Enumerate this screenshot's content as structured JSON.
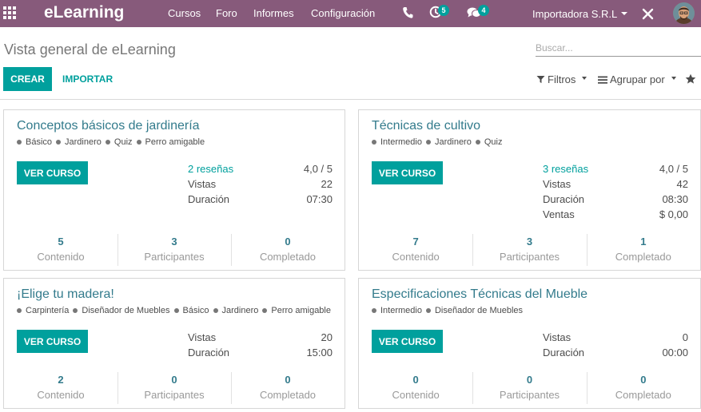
{
  "navbar": {
    "brand": "eLearning",
    "menu": [
      "Cursos",
      "Foro",
      "Informes",
      "Configuración"
    ],
    "activity_count": "5",
    "messages_count": "4",
    "company": "Importadora S.R.L",
    "icons": [
      "apps-grid-icon",
      "phone-icon",
      "activity-clock-icon",
      "chat-icon",
      "close-x-icon"
    ],
    "color": "#875a7b"
  },
  "control_panel": {
    "title": "Vista general de eLearning",
    "search_placeholder": "Buscar...",
    "create_label": "CREAR",
    "import_label": "IMPORTAR",
    "filters_label": "Filtros",
    "group_by_label": "Agrupar por"
  },
  "accent_color": "#00a09d",
  "courses": [
    {
      "title": "Conceptos básicos de jardinería",
      "tags": [
        "Básico",
        "Jardinero",
        "Quiz",
        "Perro amigable"
      ],
      "button": "VER CURSO",
      "stats": [
        {
          "label": "2 reseñas",
          "value": "4,0 / 5",
          "link": true
        },
        {
          "label": "Vistas",
          "value": "22"
        },
        {
          "label": "Duración",
          "value": "07:30"
        }
      ],
      "counters": [
        {
          "value": "5",
          "label": "Contenido"
        },
        {
          "value": "3",
          "label": "Participantes"
        },
        {
          "value": "0",
          "label": "Completado"
        }
      ]
    },
    {
      "title": "Técnicas de cultivo",
      "tags": [
        "Intermedio",
        "Jardinero",
        "Quiz"
      ],
      "button": "VER CURSO",
      "stats": [
        {
          "label": "3 reseñas",
          "value": "4,0 / 5",
          "link": true
        },
        {
          "label": "Vistas",
          "value": "42"
        },
        {
          "label": "Duración",
          "value": "08:30"
        },
        {
          "label": "Ventas",
          "value": "$ 0,00"
        }
      ],
      "counters": [
        {
          "value": "7",
          "label": "Contenido"
        },
        {
          "value": "3",
          "label": "Participantes"
        },
        {
          "value": "1",
          "label": "Completado"
        }
      ]
    },
    {
      "title": "¡Elige tu madera!",
      "tags": [
        "Carpintería",
        "Diseñador de Muebles",
        "Básico",
        "Jardinero",
        "Perro amigable"
      ],
      "button": "VER CURSO",
      "stats": [
        {
          "label": "Vistas",
          "value": "20"
        },
        {
          "label": "Duración",
          "value": "15:00"
        }
      ],
      "counters": [
        {
          "value": "2",
          "label": "Contenido"
        },
        {
          "value": "0",
          "label": "Participantes"
        },
        {
          "value": "0",
          "label": "Completado"
        }
      ]
    },
    {
      "title": "Especificaciones Técnicas del Mueble",
      "tags": [
        "Intermedio",
        "Diseñador de Muebles"
      ],
      "button": "VER CURSO",
      "stats": [
        {
          "label": "Vistas",
          "value": "0"
        },
        {
          "label": "Duración",
          "value": "00:00"
        }
      ],
      "counters": [
        {
          "value": "0",
          "label": "Contenido"
        },
        {
          "value": "0",
          "label": "Participantes"
        },
        {
          "value": "0",
          "label": "Completado"
        }
      ]
    }
  ]
}
